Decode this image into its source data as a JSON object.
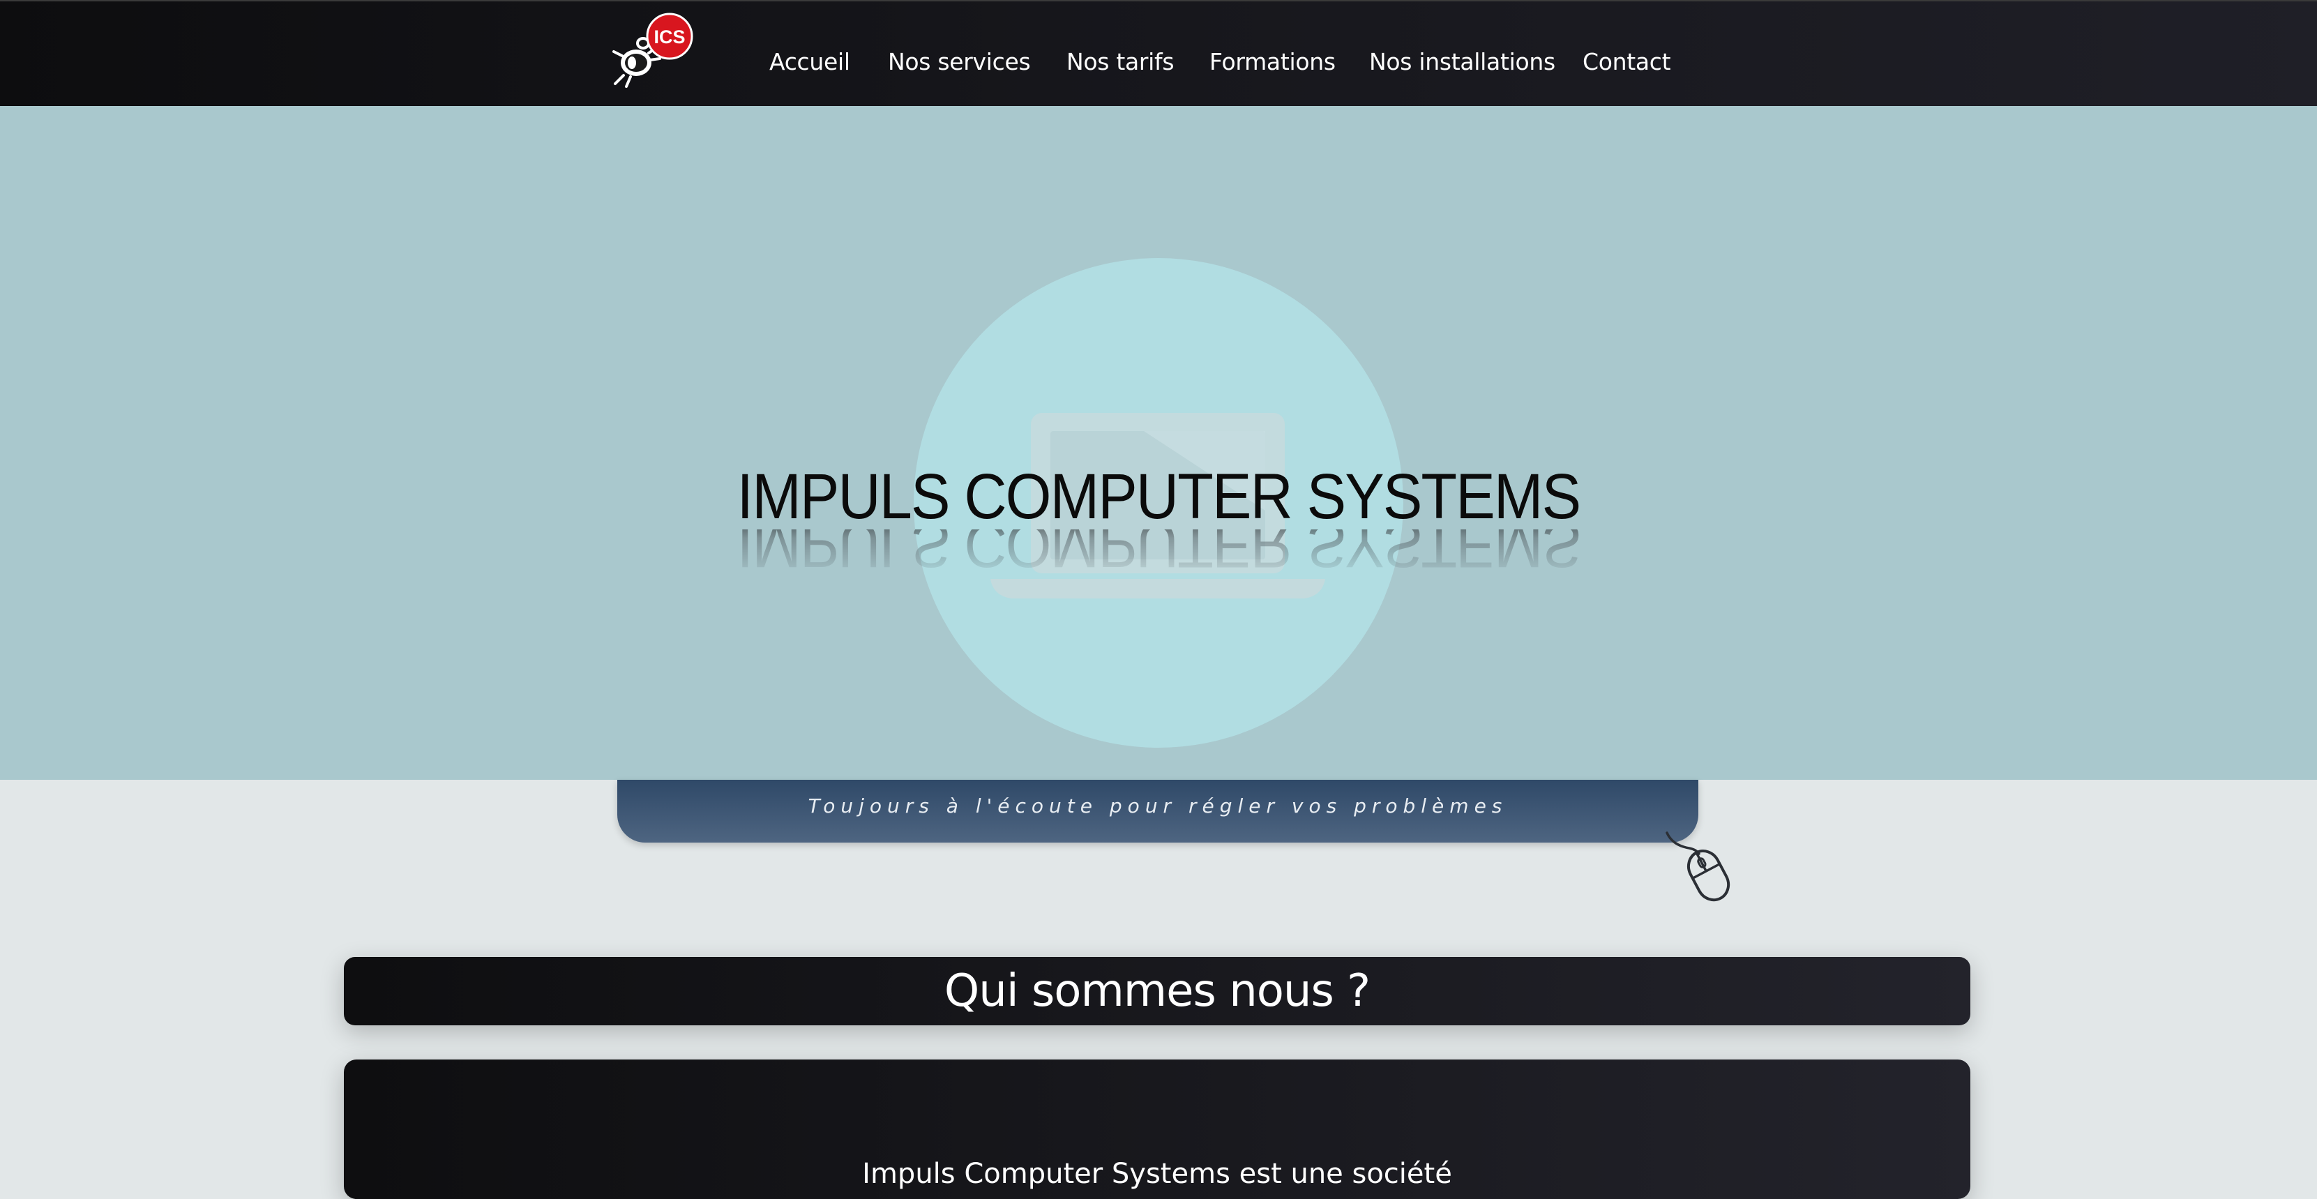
{
  "navbar": {
    "logo_text": "ICS",
    "items": [
      {
        "label": "Accueil"
      },
      {
        "label": "Nos services"
      },
      {
        "label": "Nos tarifs"
      },
      {
        "label": "Formations"
      },
      {
        "label": "Nos installations"
      },
      {
        "label": "Contact"
      }
    ]
  },
  "hero": {
    "title": "IMPULS COMPUTER SYSTEMS",
    "icon": "laptop-icon"
  },
  "tagline": {
    "text": "Toujours à l'écoute pour régler vos problèmes",
    "icon": "computer-mouse-icon"
  },
  "about": {
    "title": "Qui sommes nous ?",
    "body_partial": "Impuls Computer Systems est une société"
  },
  "colors": {
    "navbar_bg": "#16161b",
    "hero_bg": "#a9c8cd",
    "hero_circle": "#b1dde2",
    "tagline_bg": "#3e5676",
    "logo_red": "#d8161f",
    "page_bg": "#e2e7e8",
    "card_bg": "#18181d"
  }
}
